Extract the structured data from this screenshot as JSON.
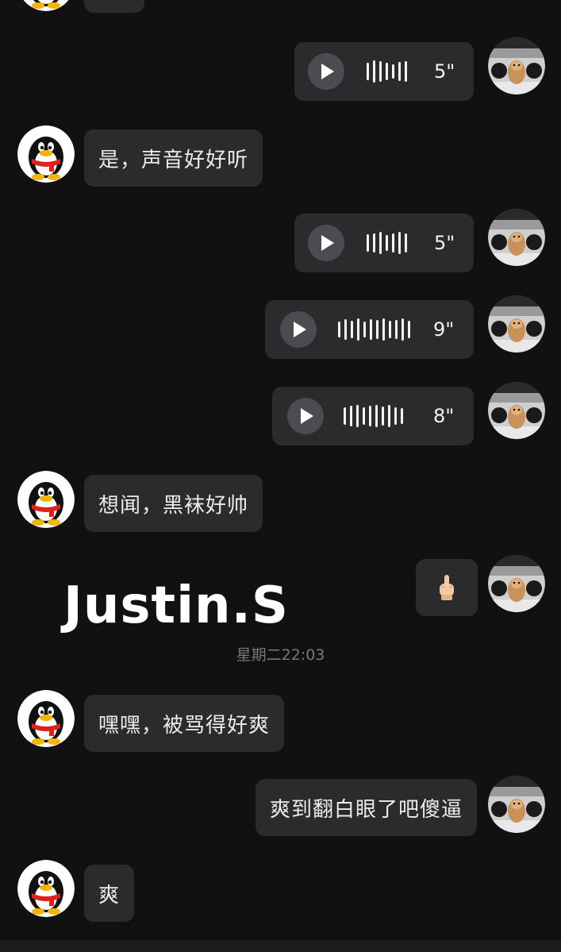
{
  "messages": [
    {
      "side": "left",
      "type": "text",
      "text": "是，声音好好听"
    },
    {
      "side": "right",
      "type": "voice",
      "duration": "5\""
    },
    {
      "side": "right",
      "type": "voice",
      "duration": "5\""
    },
    {
      "side": "right",
      "type": "voice",
      "duration": "9\""
    },
    {
      "side": "right",
      "type": "voice",
      "duration": "8\""
    },
    {
      "side": "left",
      "type": "text",
      "text": "想闻，黑袜好帅"
    },
    {
      "side": "right",
      "type": "emoji",
      "emoji": "middle-finger"
    },
    {
      "side": "left",
      "type": "text",
      "text": "嘿嘿，被骂得好爽"
    },
    {
      "side": "right",
      "type": "text",
      "text": "爽到翻白眼了吧傻逼"
    },
    {
      "side": "left",
      "type": "text",
      "text": "爽"
    }
  ],
  "overlay": {
    "watermark_text": "Justin.S"
  },
  "timestamp": "星期二22:03",
  "icons": {
    "contact_avatar": "qq-penguin-avatar",
    "self_avatar": "hamster-photo-avatar",
    "play": "play-icon",
    "waveform": "waveform-icon"
  },
  "colors": {
    "background": "#111113",
    "bubble": "#2b2b2e",
    "text": "#ececec",
    "timestamp": "#77777c"
  }
}
